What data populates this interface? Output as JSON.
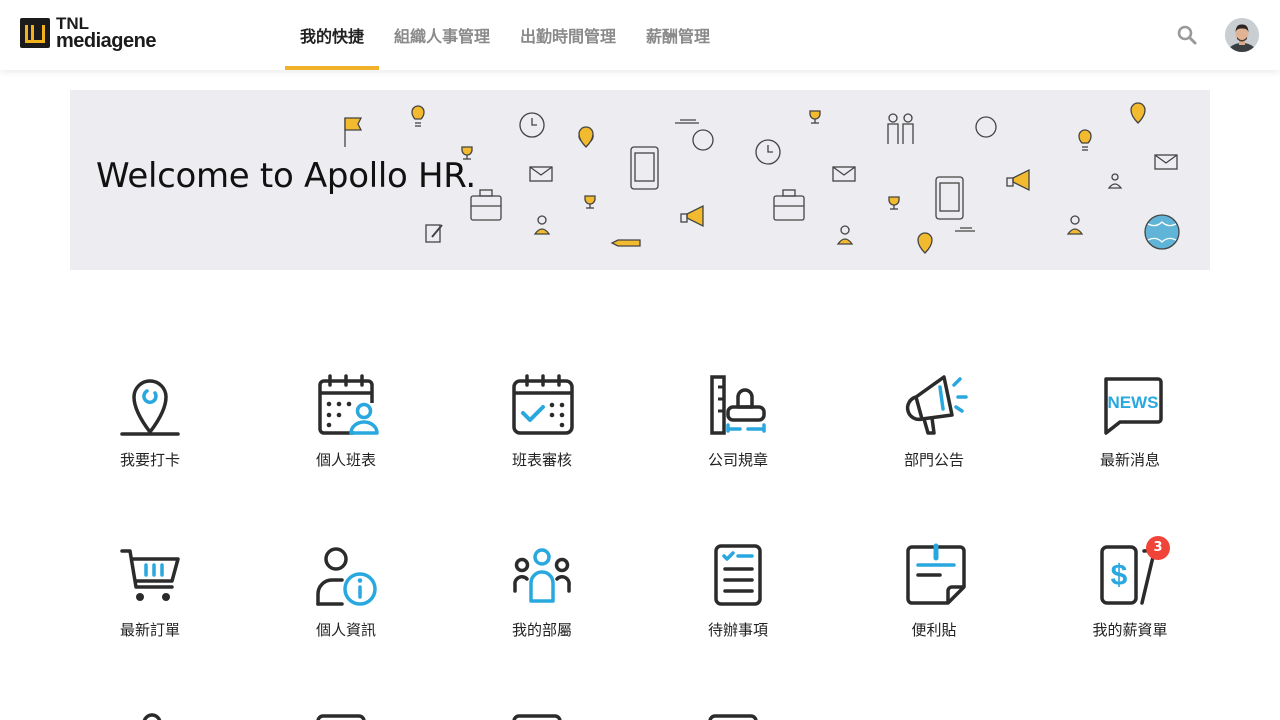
{
  "brand": {
    "line1": "TNL",
    "line2": "mediagene"
  },
  "nav": {
    "tabs": [
      {
        "label": "我的快捷",
        "active": true
      },
      {
        "label": "組織人事管理",
        "active": false
      },
      {
        "label": "出勤時間管理",
        "active": false
      },
      {
        "label": "薪酬管理",
        "active": false
      }
    ]
  },
  "header": {
    "search_icon": "search-icon",
    "avatar": "user-avatar"
  },
  "banner": {
    "title": "Welcome to Apollo HR."
  },
  "shortcuts": {
    "row1": [
      {
        "label": "我要打卡",
        "icon": "location-pin-icon"
      },
      {
        "label": "個人班表",
        "icon": "calendar-person-icon"
      },
      {
        "label": "班表審核",
        "icon": "calendar-check-icon"
      },
      {
        "label": "公司規章",
        "icon": "stamp-ruler-icon"
      },
      {
        "label": "部門公告",
        "icon": "megaphone-icon"
      },
      {
        "label": "最新消息",
        "icon": "news-bubble-icon"
      }
    ],
    "row2": [
      {
        "label": "最新訂單",
        "icon": "shopping-cart-icon"
      },
      {
        "label": "個人資訊",
        "icon": "person-info-icon"
      },
      {
        "label": "我的部屬",
        "icon": "team-icon"
      },
      {
        "label": "待辦事項",
        "icon": "checklist-icon"
      },
      {
        "label": "便利貼",
        "icon": "sticky-note-icon"
      },
      {
        "label": "我的薪資單",
        "icon": "payslip-icon",
        "badge": "3"
      }
    ]
  },
  "colors": {
    "accent": "#f0b22a",
    "icon_dark": "#2b2b2b",
    "icon_blue": "#29a8e0",
    "badge": "#f04438",
    "banner_bg": "#ededf1"
  }
}
